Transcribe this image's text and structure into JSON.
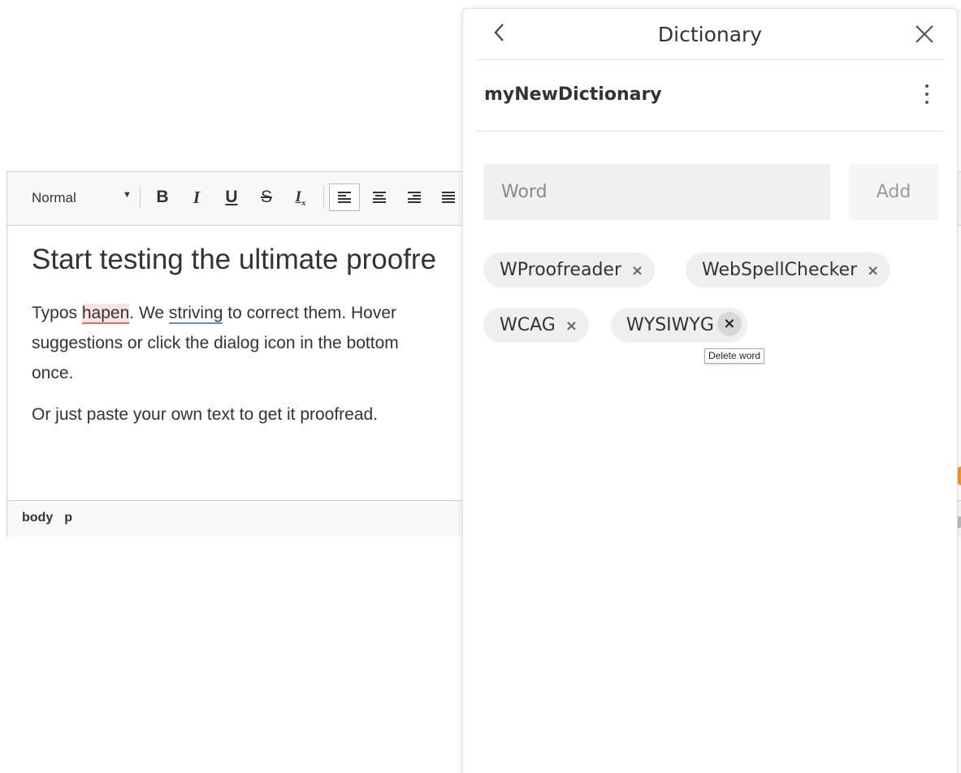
{
  "editor": {
    "format_select": "Normal",
    "toolbar": {
      "bold": "B",
      "italic": "I",
      "underline": "U",
      "strike": "S",
      "clear": "Tx"
    },
    "heading": "Start testing the ultimate proofre",
    "para1_a": "Typos ",
    "para1_err": "hapen",
    "para1_b": ". We ",
    "para1_gram": "striving",
    "para1_c": " to correct them. Hover",
    "para1_line2": "suggestions or click the dialog icon in the bottom",
    "para1_line3": "once.",
    "para2": "Or just paste your own text to get it proofread.",
    "status": [
      "body",
      "p"
    ]
  },
  "dictionary": {
    "title": "Dictionary",
    "name": "myNewDictionary",
    "input_placeholder": "Word",
    "add_label": "Add",
    "words": [
      "WProofreader",
      "WebSpellChecker",
      "WCAG",
      "WYSIWYG"
    ],
    "remove_glyph": "×",
    "tooltip": "Delete word"
  },
  "colors": {
    "error_underline": "#e06c6c",
    "grammar_underline": "#5b8fd6",
    "accent_dot": "#f7941d"
  }
}
